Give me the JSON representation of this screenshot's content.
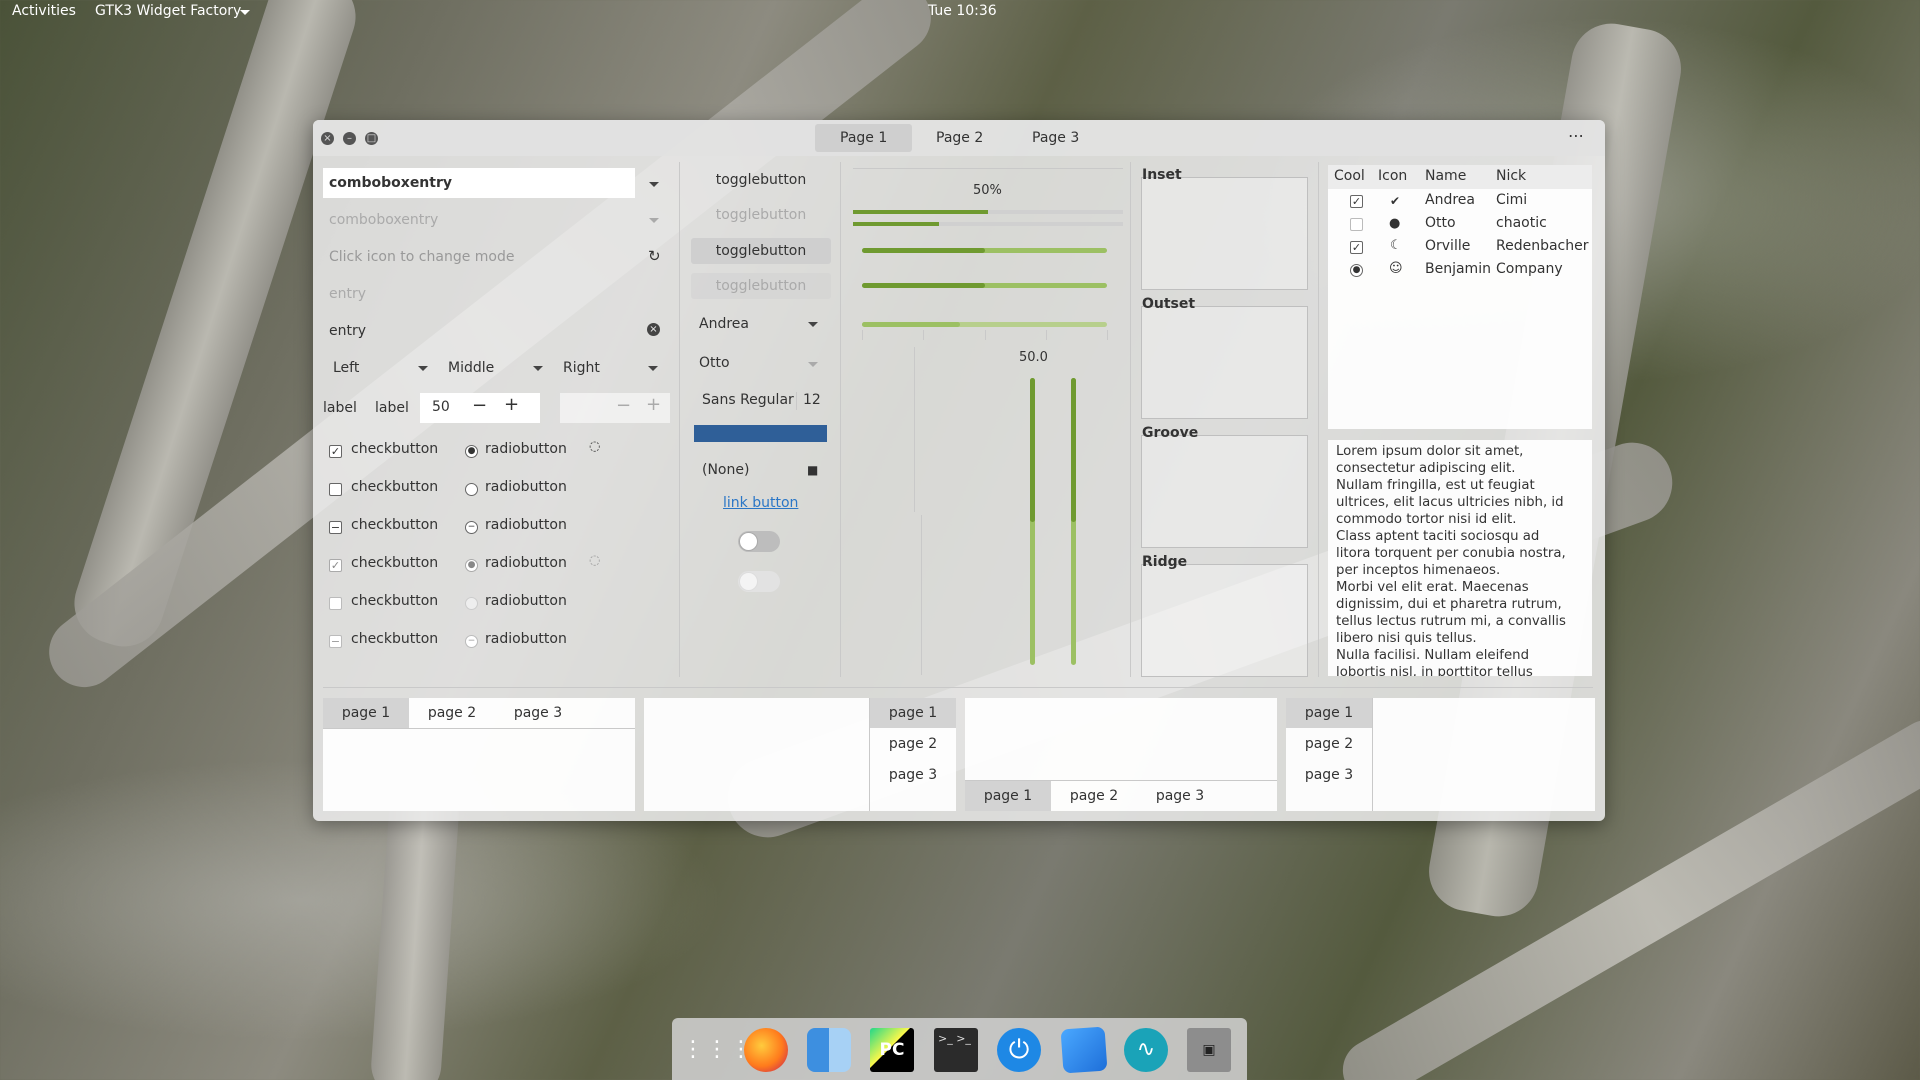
{
  "topbar": {
    "activities": "Activities",
    "app_menu": "GTK3 Widget Factory",
    "clock": "Tue 10:36"
  },
  "window": {
    "tabs": [
      "Page 1",
      "Page 2",
      "Page 3"
    ],
    "menu_icon": "more-icon",
    "col1": {
      "combo1": "comboboxentry",
      "combo2": "comboboxentry",
      "entry_mode": "Click icon to change mode",
      "entry_placeholder": "entry",
      "entry_value": "entry",
      "align": [
        "Left",
        "Middle",
        "Right"
      ],
      "label1": "label",
      "label2": "label",
      "spin_value": "50",
      "check": "checkbutton",
      "radio": "radiobutton"
    },
    "col2": {
      "toggle": "togglebutton",
      "combo_andrea": "Andrea",
      "combo_otto": "Otto",
      "font": "Sans Regular",
      "font_size": "12",
      "file": "(None)",
      "link": "link button",
      "accent": "#2f5f98"
    },
    "col3": {
      "progress_label": "50%",
      "scale_value": "50.0",
      "progress": 0.5,
      "accent": "#6f9a30"
    },
    "frames": [
      "Inset",
      "Outset",
      "Groove",
      "Ridge"
    ],
    "tree": {
      "headers": [
        "Cool",
        "Icon",
        "Name",
        "Nick"
      ],
      "rows": [
        {
          "cool": "checked",
          "icon": "check-circle-icon",
          "name": "Andrea",
          "nick": "Cimi"
        },
        {
          "cool": "unchecked",
          "icon": "info-circle-icon",
          "name": "Otto",
          "nick": "chaotic"
        },
        {
          "cool": "checked",
          "icon": "moon-icon",
          "name": "Orville",
          "nick": "Redenbacher"
        },
        {
          "cool": "radio",
          "icon": "face-icon",
          "name": "Benjamin",
          "nick": "Company"
        }
      ]
    },
    "text": [
      "Lorem ipsum dolor sit amet,",
      "consectetur adipiscing elit.",
      "Nullam fringilla, est ut feugiat",
      "ultrices, elit lacus ultricies nibh, id",
      "commodo tortor nisi id elit.",
      "Class aptent taciti sociosqu ad",
      "litora torquent per conubia nostra,",
      "per inceptos himenaeos.",
      "Morbi vel elit erat. Maecenas",
      "dignissim, dui et pharetra rutrum,",
      "tellus lectus rutrum mi, a convallis",
      "libero nisi quis tellus.",
      "Nulla facilisi. Nullam eleifend",
      "lobortis nisl, in porttitor tellus"
    ],
    "notebook_tabs": [
      "page 1",
      "page 2",
      "page 3"
    ]
  },
  "dock": [
    "apps-grid-icon",
    "firefox-icon",
    "finder-icon",
    "pycharm-icon",
    "terminal-icon",
    "power-icon",
    "notes-icon",
    "audio-icon",
    "screen-icon"
  ]
}
